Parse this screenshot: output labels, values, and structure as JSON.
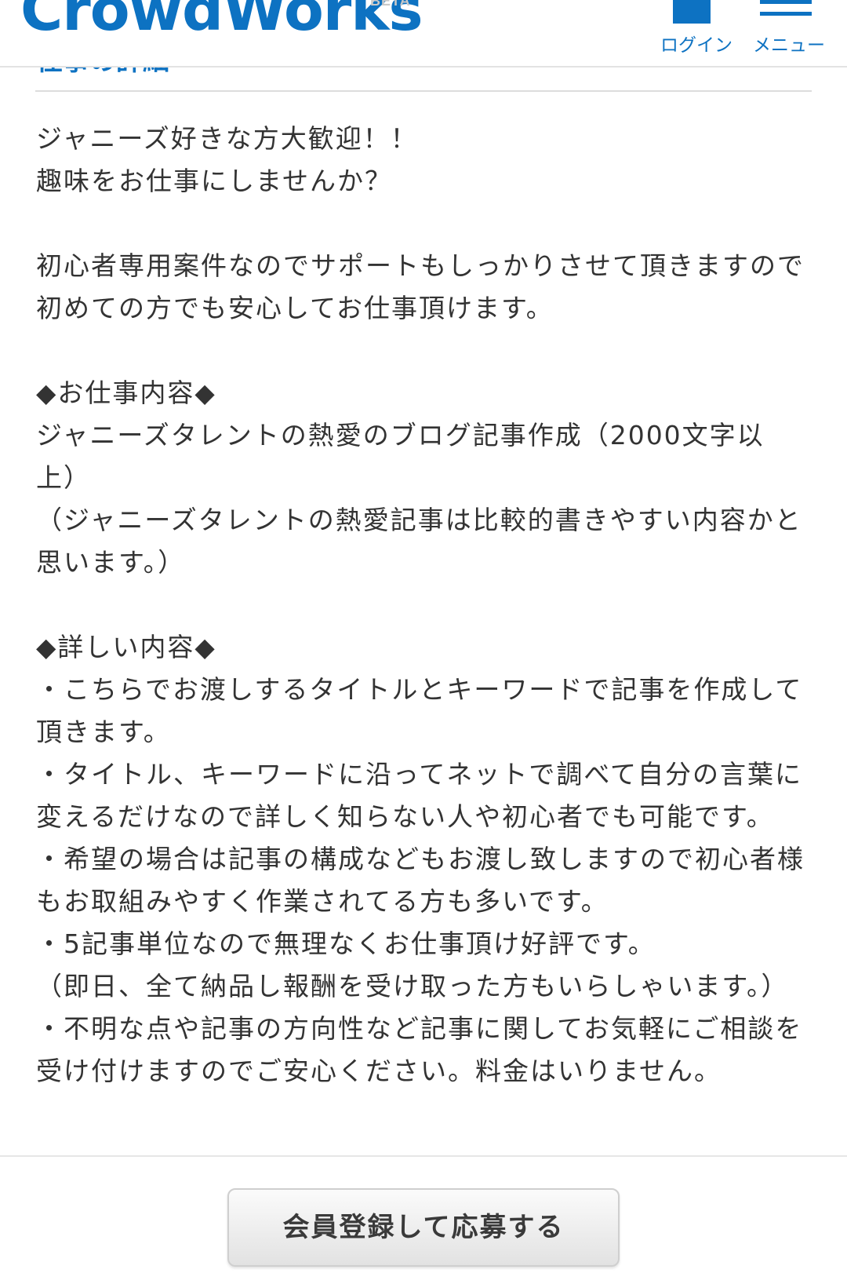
{
  "header": {
    "logo_text": "CrowdWorks",
    "beta_label": "BETA",
    "login_label": "ログイン",
    "menu_label": "メニュー",
    "brand_color": "#0d72c2"
  },
  "section": {
    "title": "仕事の詳細"
  },
  "job": {
    "description": "ジャニーズ好きな方大歓迎！！\n趣味をお仕事にしませんか？\n\n初心者専用案件なのでサポートもしっかりさせて頂きますので\n初めての方でも安心してお仕事頂けます。\n\n◆お仕事内容◆\nジャニーズタレントの熱愛のブログ記事作成（2000文字以上）\n（ジャニーズタレントの熱愛記事は比較的書きやすい内容かと思います。）\n\n◆詳しい内容◆\n・こちらでお渡しするタイトルとキーワードで記事を作成して頂きます。\n・タイトル、キーワードに沿ってネットで調べて自分の言葉に変えるだけなので詳しく知らない人や初心者でも可能です。\n・希望の場合は記事の構成などもお渡し致しますので初心者様もお取組みやすく作業されてる方も多いです。\n・5記事単位なので無理なくお仕事頂け好評です。\n（即日、全て納品し報酬を受け取った方もいらしゃいます。）\n・不明な点や記事の方向性など記事に関してお気軽にご相談を受け付けますのでご安心ください。料金はいりません。"
  },
  "apply": {
    "button_label": "会員登録して応募する"
  }
}
